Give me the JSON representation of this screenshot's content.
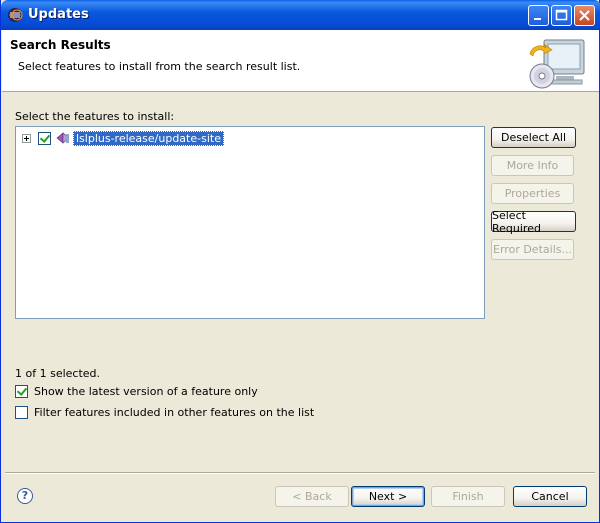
{
  "window": {
    "title": "Updates"
  },
  "header": {
    "title": "Search Results",
    "description": "Select features to install from the search result list."
  },
  "main": {
    "list_label": "Select the features to install:",
    "tree": [
      {
        "label": "lslplus-release/update-site",
        "checked": true,
        "expanded": false,
        "selected": true
      }
    ],
    "status": "1 of 1 selected.",
    "options": [
      {
        "label": "Show the latest version of a feature only",
        "checked": true
      },
      {
        "label": "Filter features included in other features on the list",
        "checked": false
      }
    ]
  },
  "side_buttons": {
    "deselect_all": "Deselect All",
    "more_info": "More Info",
    "properties": "Properties",
    "select_required": "Select Required",
    "error_details": "Error Details..."
  },
  "footer": {
    "back": "< Back",
    "next": "Next >",
    "finish": "Finish",
    "cancel": "Cancel",
    "help_glyph": "?"
  },
  "colors": {
    "titlebar": "#0A59DD",
    "selection": "#316AC5",
    "dialog_bg": "#ECE9D8"
  }
}
